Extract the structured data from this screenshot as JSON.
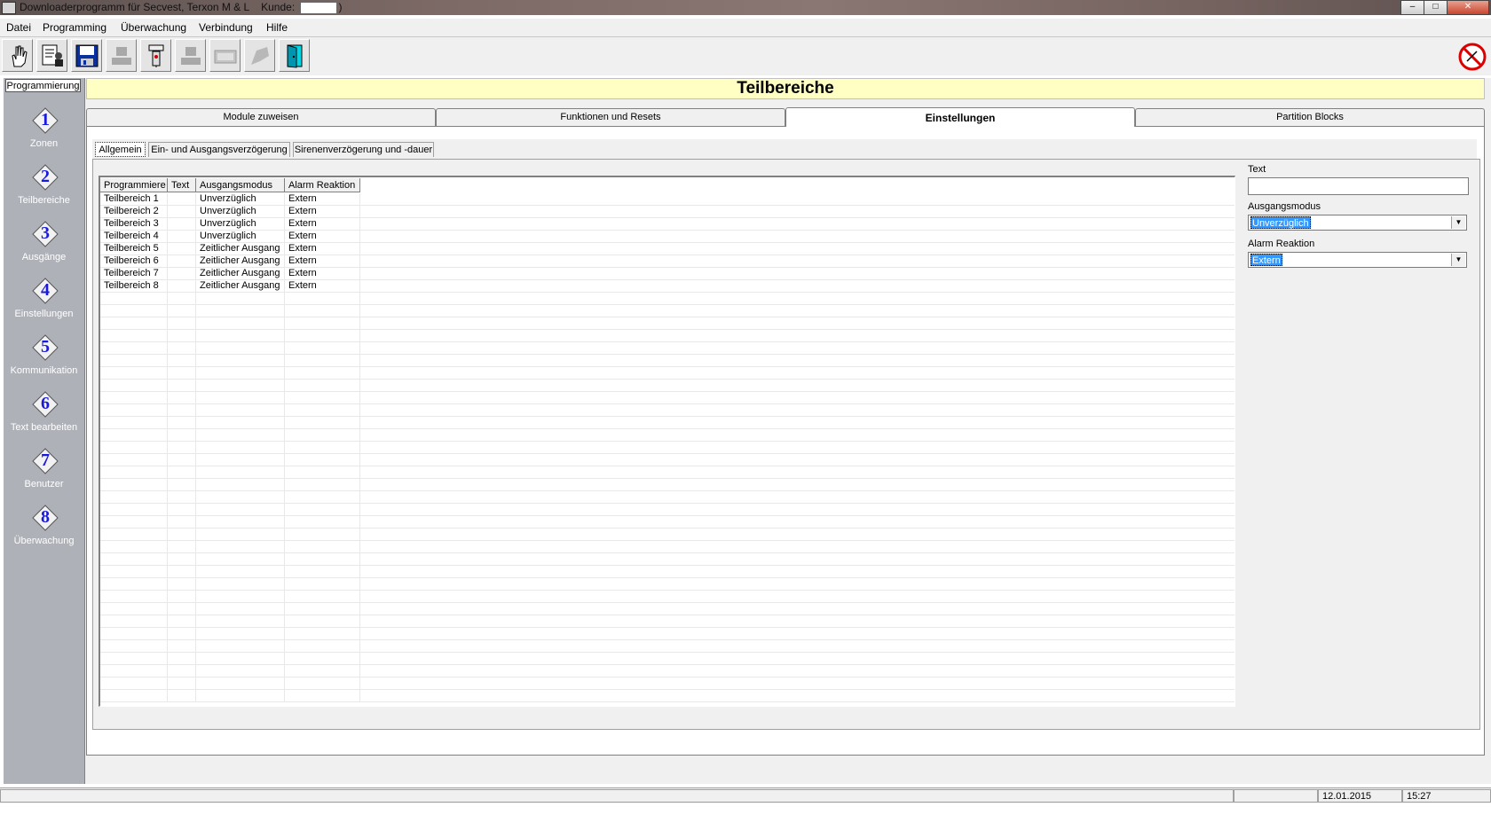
{
  "window": {
    "title": "Downloaderprogramm für Secvest, Terxon M & L",
    "kunde_label": "Kunde:",
    "kunde_close": ")"
  },
  "menu": [
    "Datei",
    "Programming",
    "Überwachung",
    "Verbindung",
    "Hilfe"
  ],
  "sidebar": {
    "header": "Programmierung",
    "items": [
      {
        "number": "1",
        "label": "Zonen"
      },
      {
        "number": "2",
        "label": "Teilbereiche"
      },
      {
        "number": "3",
        "label": "Ausgänge"
      },
      {
        "number": "4",
        "label": "Einstellungen"
      },
      {
        "number": "5",
        "label": "Kommunikation"
      },
      {
        "number": "6",
        "label": "Text bearbeiten"
      },
      {
        "number": "7",
        "label": "Benutzer"
      },
      {
        "number": "8",
        "label": "Überwachung"
      }
    ]
  },
  "page": {
    "title": "Teilbereiche"
  },
  "tabs": [
    {
      "label": "Module zuweisen"
    },
    {
      "label": "Funktionen und Resets"
    },
    {
      "label": "Einstellungen",
      "active": true
    },
    {
      "label": "Partition Blocks"
    }
  ],
  "subtabs": [
    {
      "label": "Allgemein",
      "active": true
    },
    {
      "label": "Ein- und Ausgangsverzögerung"
    },
    {
      "label": "Sirenenverzögerung und -dauer"
    }
  ],
  "grid": {
    "columns": [
      "Programmiere",
      "Text",
      "Ausgangsmodus",
      "Alarm Reaktion"
    ],
    "rows": [
      [
        "Teilbereich 1",
        "",
        "Unverzüglich",
        "Extern"
      ],
      [
        "Teilbereich 2",
        "",
        "Unverzüglich",
        "Extern"
      ],
      [
        "Teilbereich 3",
        "",
        "Unverzüglich",
        "Extern"
      ],
      [
        "Teilbereich 4",
        "",
        "Unverzüglich",
        "Extern"
      ],
      [
        "Teilbereich 5",
        "",
        "Zeitlicher Ausgang",
        "Extern"
      ],
      [
        "Teilbereich 6",
        "",
        "Zeitlicher Ausgang",
        "Extern"
      ],
      [
        "Teilbereich 7",
        "",
        "Zeitlicher Ausgang",
        "Extern"
      ],
      [
        "Teilbereich 8",
        "",
        "Zeitlicher Ausgang",
        "Extern"
      ]
    ]
  },
  "form": {
    "text_label": "Text",
    "text_value": "",
    "ausgangsmodus_label": "Ausgangsmodus",
    "ausgangsmodus_value": "Unverzüglich",
    "alarm_label": "Alarm Reaktion",
    "alarm_value": "Extern"
  },
  "status": {
    "date": "12.01.2015",
    "time": "15:27"
  },
  "toolbar_icons": [
    "hand-icon",
    "document-person-icon",
    "floppy-save-icon",
    "computer-disabled-icon",
    "connect-device-icon",
    "computer-disabled-icon-2",
    "keypad-disabled-icon",
    "modem-disabled-icon",
    "exit-door-icon"
  ],
  "colors": {
    "header_bg": "#ffffc4",
    "sidebar_bg": "#aeb1b8",
    "diamond_number": "#1a1adc",
    "selection": "#3399ff"
  }
}
